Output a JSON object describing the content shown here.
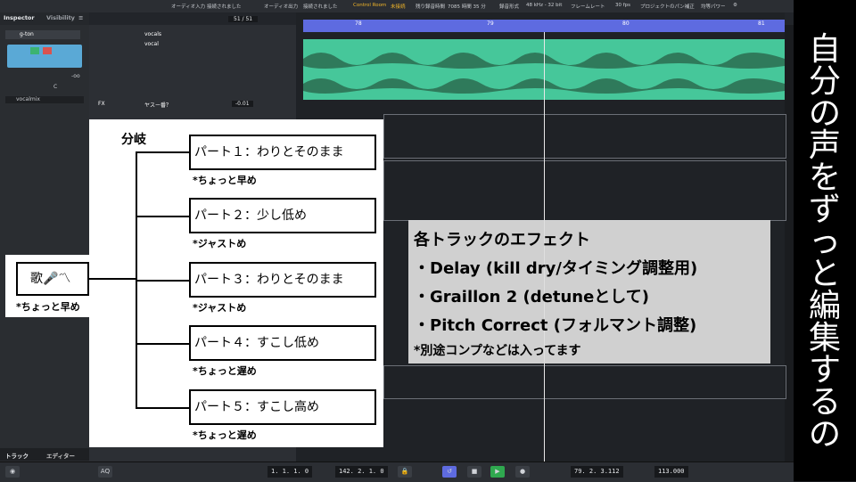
{
  "daw": {
    "topbar": {
      "items": [
        "オーディオ入力",
        "接続されました",
        "オーディオ出力",
        "接続されました",
        "Control Room",
        "未接続",
        "残り録音時間",
        "7085 時間 35 分",
        "録音形式",
        "48 kHz - 32 bit",
        "フレームレート",
        "30 fps",
        "プロジェクトのパン補正",
        "均等パワー"
      ]
    },
    "inspector": {
      "tab_inspector": "Inspector",
      "tab_visibility": "Visibility",
      "track_name": "g-ton",
      "vol_value": "-oo",
      "pan_value": "C",
      "route": "vocalmix",
      "bottom_tab_track": "トラック",
      "bottom_tab_editor": "エディター"
    },
    "tracklist": {
      "counter": "51 / 51",
      "folder_name": "vocals",
      "track_name": "vocal",
      "fx_label": "FX",
      "fx_name": "ヤスー番？",
      "fx_value": "-0.01"
    },
    "ruler": {
      "ticks": [
        "78",
        "79",
        "80",
        "81"
      ]
    },
    "transport": {
      "pos_left": "1. 1. 1. 0",
      "pos_right": "142. 2. 1. 0",
      "position": "79. 2. 3.112",
      "tempo": "113.000",
      "aq": "AQ"
    }
  },
  "annotation": {
    "title": "分岐",
    "source": {
      "label": "歌🎤〽",
      "note": "*ちょっと早め"
    },
    "parts": [
      {
        "label": "パート１：わりとそのまま",
        "note": "*ちょっと早め"
      },
      {
        "label": "パート２：少し低め",
        "note": "*ジャストめ"
      },
      {
        "label": "パート３：わりとそのまま",
        "note": "*ジャストめ"
      },
      {
        "label": "パート４：すこし低め",
        "note": "*ちょっと遅め"
      },
      {
        "label": "パート５：すこし高め",
        "note": "*ちょっと遅め"
      }
    ],
    "effects": {
      "heading": "各トラックのエフェクト",
      "items": [
        "・Delay (kill dry/タイミング調整用)",
        "・Graillon 2 (detuneとして)",
        "・Pitch Correct (フォルマント調整)"
      ],
      "footnote": "*別途コンプなどは入ってます"
    },
    "vertical_text": [
      "自",
      "分",
      "の",
      "声",
      "を",
      "ず",
      "っ",
      "と",
      "編",
      "集",
      "す",
      "る",
      "の"
    ]
  }
}
